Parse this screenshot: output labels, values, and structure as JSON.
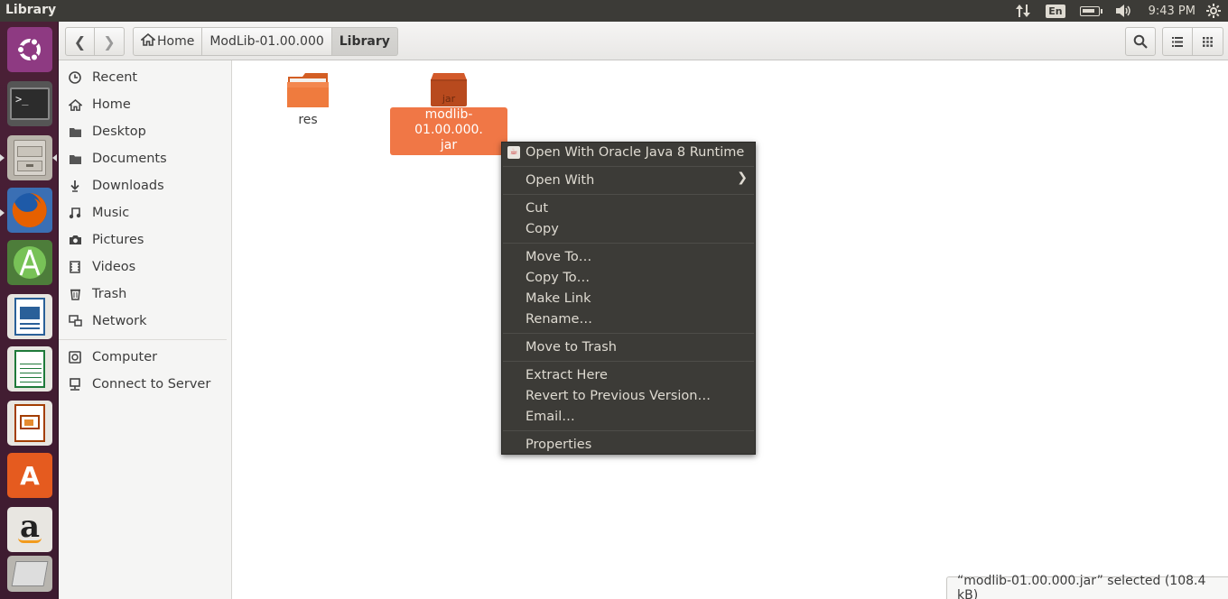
{
  "top_panel": {
    "title": "Library",
    "keyboard_layout": "En",
    "time": "9:43 PM"
  },
  "launcher": {
    "items": [
      {
        "name": "Ubuntu Dash",
        "icon": "ubuntu-logo-icon",
        "color": "#9b3b8c"
      },
      {
        "name": "Terminal",
        "icon": "terminal-icon",
        "color": "#2d2d2d"
      },
      {
        "name": "Files",
        "icon": "file-cabinet-icon",
        "color": "#b9b4ab"
      },
      {
        "name": "Firefox",
        "icon": "firefox-icon",
        "color": "#e66000"
      },
      {
        "name": "Android Studio",
        "icon": "android-studio-icon",
        "color": "#78c257"
      },
      {
        "name": "LibreOffice Writer",
        "icon": "writer-icon",
        "color": "#2a6099"
      },
      {
        "name": "LibreOffice Calc",
        "icon": "calc-icon",
        "color": "#1f7a3a"
      },
      {
        "name": "LibreOffice Impress",
        "icon": "impress-icon",
        "color": "#a33e03"
      },
      {
        "name": "Ubuntu Software",
        "icon": "software-center-icon",
        "color": "#e55b1f"
      },
      {
        "name": "Amazon",
        "icon": "amazon-icon",
        "color": "#e8e6e1"
      },
      {
        "name": "Workspace Switcher",
        "icon": "workspace-icon",
        "color": "#c7c4bf"
      }
    ]
  },
  "toolbar": {
    "breadcrumbs": [
      "Home",
      "ModLib-01.00.000",
      "Library"
    ]
  },
  "sidebar": {
    "places": [
      {
        "label": "Recent",
        "icon": "clock-icon"
      },
      {
        "label": "Home",
        "icon": "home-icon"
      },
      {
        "label": "Desktop",
        "icon": "desktop-folder-icon"
      },
      {
        "label": "Documents",
        "icon": "documents-icon"
      },
      {
        "label": "Downloads",
        "icon": "download-icon"
      },
      {
        "label": "Music",
        "icon": "music-icon"
      },
      {
        "label": "Pictures",
        "icon": "camera-icon"
      },
      {
        "label": "Videos",
        "icon": "video-icon"
      },
      {
        "label": "Trash",
        "icon": "trash-icon"
      },
      {
        "label": "Network",
        "icon": "network-icon"
      }
    ],
    "devices": [
      {
        "label": "Computer",
        "icon": "computer-icon"
      },
      {
        "label": "Connect to Server",
        "icon": "server-icon"
      }
    ]
  },
  "files": [
    {
      "name": "res",
      "type": "folder"
    },
    {
      "name_line1": "modlib-01.00.000.",
      "name_line2": "jar",
      "type": "jar",
      "badge": "jar",
      "selected": true
    }
  ],
  "context_menu": {
    "items": [
      "Open With Oracle Java 8 Runtime",
      "Open With",
      "Cut",
      "Copy",
      "Move To…",
      "Copy To…",
      "Make Link",
      "Rename…",
      "Move to Trash",
      "Extract Here",
      "Revert to Previous Version…",
      "Email…",
      "Properties"
    ]
  },
  "status_bar": {
    "text": "“modlib-01.00.000.jar” selected  (108.4 kB)"
  },
  "colors": {
    "accent": "#f07746",
    "panel": "#3c3b37",
    "launcher": "#4b2037"
  }
}
